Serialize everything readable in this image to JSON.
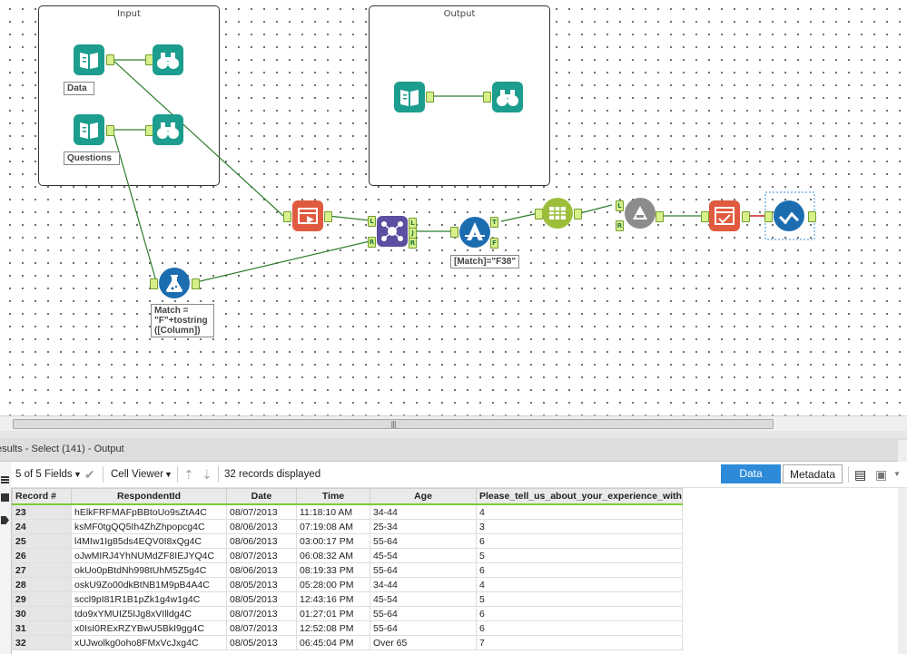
{
  "canvas": {
    "containers": [
      {
        "id": "input",
        "title": "Input"
      },
      {
        "id": "output",
        "title": "Output"
      }
    ],
    "labels": {
      "data": "Data",
      "questions": "Questions",
      "formula": "Match =\n\"F\"+tostring\n([Column])",
      "filter": "[Match]=\"F38\""
    },
    "anchors": {
      "left": "L",
      "right": "R",
      "join": "J",
      "true": "T",
      "false": "F"
    },
    "colors": {
      "teal": "#1c9d8e",
      "blue": "#1c6db0",
      "red": "#e05a3f",
      "purple": "#5b4fa1",
      "olive": "#9cbe3a",
      "gray": "#8c8c8c",
      "wire": "#2d7d2d",
      "wireRed": "#cc2222"
    }
  },
  "results": {
    "title": "esults - Select (141) - Output",
    "fields_label": "5 of 5 Fields",
    "cell_viewer_label": "Cell Viewer",
    "records_label": "32 records displayed",
    "data_tab": "Data",
    "metadata_tab": "Metadata"
  },
  "table": {
    "columns": [
      "Record #",
      "RespondentId",
      "Date",
      "Time",
      "Age",
      "Please_tell_us_about_your_experience_with_..."
    ],
    "rows": [
      [
        "23",
        "hElkFRFMAFpBBtoUo9sZtA4C",
        "08/07/2013",
        "11:18:10 AM",
        "34-44",
        "4"
      ],
      [
        "24",
        "ksMF0tgQQ5Ih4ZhZhpopcg4C",
        "08/06/2013",
        "07:19:08 AM",
        "25-34",
        "3"
      ],
      [
        "25",
        "l4MIw1Ig85ds4EQV0I8xQg4C",
        "08/06/2013",
        "03:00:17 PM",
        "55-64",
        "6"
      ],
      [
        "26",
        "oJwMIRJ4YhNUMdZF8IEJYQ4C",
        "08/07/2013",
        "06:08:32 AM",
        "45-54",
        "5"
      ],
      [
        "27",
        "okUo0pBtdNh998tUhM5Z5g4C",
        "08/06/2013",
        "08:19:33 PM",
        "55-64",
        "6"
      ],
      [
        "28",
        "oskU9Zo00dkBtNB1M9pB4A4C",
        "08/05/2013",
        "05:28:00 PM",
        "34-44",
        "4"
      ],
      [
        "29",
        "sccl9pI81R1B1pZk1g4w1g4C",
        "08/05/2013",
        "12:43:16 PM",
        "45-54",
        "5"
      ],
      [
        "30",
        "tdo9xYMUIZ5IJg8xVIlldg4C",
        "08/07/2013",
        "01:27:01 PM",
        "55-64",
        "6"
      ],
      [
        "31",
        "x0IsI0RExRZYBwU5BkI9gg4C",
        "08/07/2013",
        "12:52:08 PM",
        "55-64",
        "6"
      ],
      [
        "32",
        "xUJwolkg0oho8FMxVcJxg4C",
        "08/05/2013",
        "06:45:04 PM",
        "Over 65",
        "7"
      ]
    ]
  }
}
